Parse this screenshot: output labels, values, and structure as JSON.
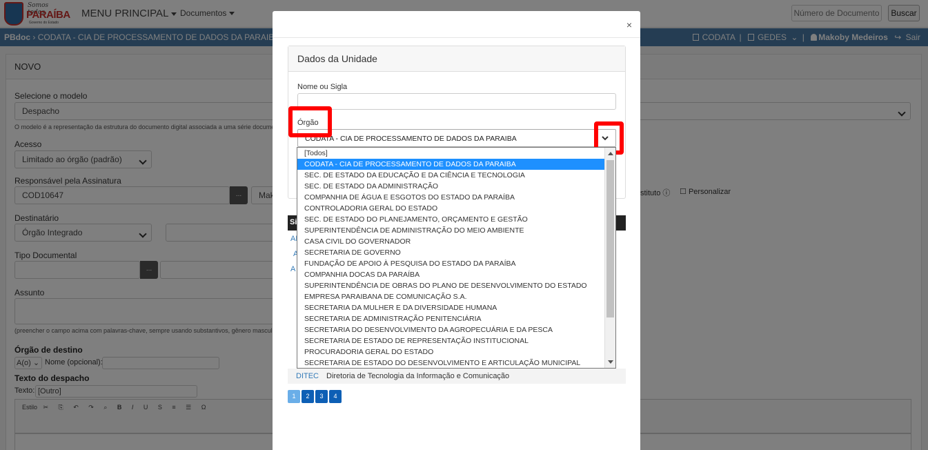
{
  "topbar": {
    "logo": {
      "line1": "Somos todos",
      "line2": "PARAÍBA",
      "line3": "Governo do Estado"
    },
    "menu_main": "MENU PRINCIPAL",
    "menu_docs": "Documentos",
    "doc_number_placeholder": "Número de Documento",
    "search_label": "Buscar"
  },
  "bluebar": {
    "app": "PBdoc",
    "breadcrumb": "CODATA - CIA DE PROCESSAMENTO DE DADOS DA PARAIBA",
    "org": "CODATA",
    "unit": "GEDES",
    "user": "Makoby Medeiros",
    "logout": "Sair"
  },
  "form": {
    "title": "NOVO",
    "model_label": "Selecione o modelo",
    "model_value": "Despacho",
    "model_help": "O modelo é a representação da estrutura do documento digital associada a uma série documental",
    "access_label": "Acesso",
    "access_value": "Limitado ao órgão (padrão)",
    "signer_label": "Responsável pela Assinatura",
    "signer_value": "COD10647",
    "signer_name_fragment": "Mak",
    "dots": "...",
    "substitute_fragment": "stituto",
    "customize_label": "Personalizar",
    "recipient_label": "Destinatário",
    "recipient_value": "Órgão Integrado",
    "doc_type_label": "Tipo Documental",
    "subject_label": "Assunto",
    "subject_help": "(preencher o campo acima com palavras-chave, sempre usando substantivos, gênero masculino e si",
    "dest_org_label": "Órgão de destino",
    "dest_select": "A(o)",
    "dest_name_label": "Nome (opcional):",
    "dispatch_text_label": "Texto do despacho",
    "text_label": "Texto:",
    "text_value": "[Outro]",
    "editor_style": "Estilo"
  },
  "modal": {
    "close": "×",
    "card_title": "Dados da Unidade",
    "name_label": "Nome ou Sigla",
    "org_label": "Órgão",
    "org_selected": "CODATA - CIA DE PROCESSAMENTO DE DADOS DA PARAIBA",
    "table_header_fragment": "Si",
    "row_fragments": [
      "AP",
      "A",
      "A"
    ],
    "last_row": {
      "code": "DITEC",
      "name": "Diretoria de Tecnologia da Informação e Comunicação"
    },
    "pages": [
      "1",
      "2",
      "3",
      "4"
    ]
  },
  "dropdown": {
    "selected_index": 1,
    "options": [
      "[Todos]",
      "CODATA - CIA DE PROCESSAMENTO DE DADOS DA PARAIBA",
      "SEC. DE ESTADO DA EDUCAÇÃO E DA CIÊNCIA E TECNOLOGIA",
      "SEC. DE ESTADO DA ADMINISTRAÇÃO",
      "COMPANHIA DE ÁGUA E ESGOTOS DO ESTADO DA PARAÍBA",
      "CONTROLADORIA GERAL DO ESTADO",
      "SEC. DE ESTADO DO PLANEJAMENTO, ORÇAMENTO E GESTÃO",
      "SUPERINTENDÊNCIA DE ADMINISTRAÇÃO DO MEIO AMBIENTE",
      "CASA CIVIL DO GOVERNADOR",
      "SECRETARIA DE GOVERNO",
      "FUNDAÇÃO DE APOIO À PESQUISA DO ESTADO DA PARAÍBA",
      "COMPANHIA DOCAS DA PARAÍBA",
      "SUPERINTENDÊNCIA DE OBRAS DO PLANO DE DESENVOLVIMENTO DO ESTADO",
      "EMPRESA PARAIBANA DE COMUNICAÇÃO S.A.",
      "SECRETARIA DA MULHER E DA DIVERSIDADE HUMANA",
      "SECRETARIA DE ADMINISTRAÇÃO PENITENCIÁRIA",
      "SECRETARIA DO DESENVOLVIMENTO DA AGROPECUÁRIA E DA PESCA",
      "SECRETARIA DE ESTADO DE REPRESENTAÇÃO INSTITUCIONAL",
      "PROCURADORIA GERAL DO ESTADO",
      "SECRETARIA DE ESTADO DO DESENVOLVIMENTO E ARTICULAÇÃO MUNICIPAL"
    ]
  },
  "colors": {
    "brand_blue": "#4a7ba6",
    "highlight": "#ff0000",
    "selected_option": "#1e90ff"
  }
}
